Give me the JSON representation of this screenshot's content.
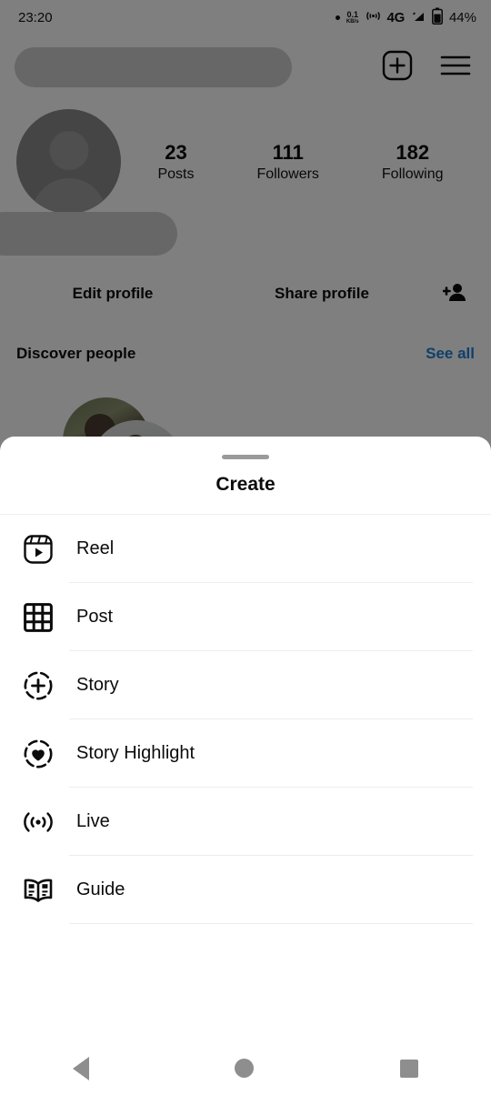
{
  "status_bar": {
    "time": "23:20",
    "net_speed_value": "0.1",
    "net_speed_unit": "KB/s",
    "network_type": "4G",
    "battery_percent": "44%"
  },
  "app_header": {
    "username_redacted": true,
    "add_icon": "plus-square-icon",
    "menu_icon": "hamburger-menu-icon"
  },
  "profile": {
    "avatar_icon": "default-avatar-icon",
    "display_name_redacted": true,
    "stats": [
      {
        "value": "23",
        "label": "Posts"
      },
      {
        "value": "111",
        "label": "Followers"
      },
      {
        "value": "182",
        "label": "Following"
      }
    ],
    "buttons": {
      "edit_profile": "Edit profile",
      "share_profile": "Share profile",
      "discover_people_icon": "add-person-icon"
    }
  },
  "discover": {
    "title": "Discover people",
    "see_all": "See all",
    "see_all_color": "#1c7fd6"
  },
  "sheet": {
    "title": "Create",
    "items": [
      {
        "label": "Reel",
        "icon": "reel-icon"
      },
      {
        "label": "Post",
        "icon": "grid-post-icon"
      },
      {
        "label": "Story",
        "icon": "story-plus-icon"
      },
      {
        "label": "Story Highlight",
        "icon": "story-highlight-heart-icon"
      },
      {
        "label": "Live",
        "icon": "live-broadcast-icon"
      },
      {
        "label": "Guide",
        "icon": "guide-book-icon"
      }
    ]
  },
  "nav_bar": {
    "back": "back-button",
    "home": "home-button",
    "recents": "recents-button"
  }
}
